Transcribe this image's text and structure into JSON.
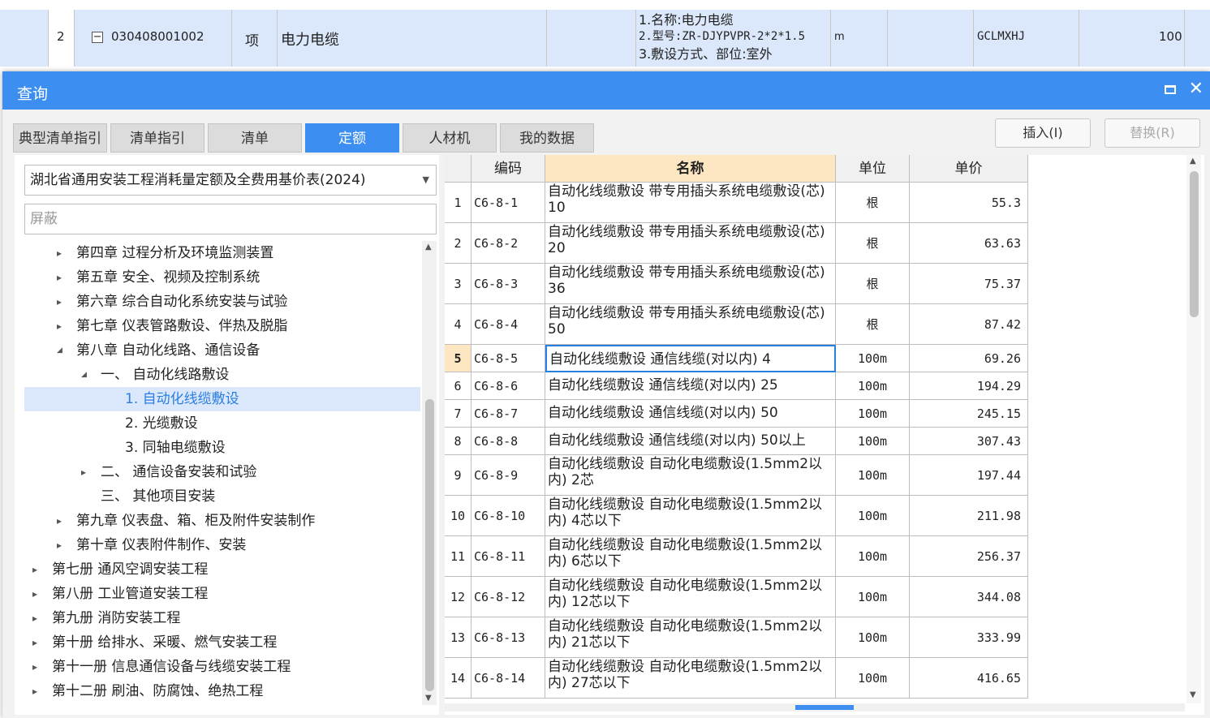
{
  "background_row": {
    "number": "2",
    "code": "030408001002",
    "type": "项",
    "name": "电力电缆",
    "features": [
      "1.名称:电力电缆",
      "2.型号:ZR-DJYPVPR-2*2*1.5",
      "3.敷设方式、部位:室外"
    ],
    "unit": "m",
    "expr": "GCLMXHJ",
    "qty": "100"
  },
  "dialog": {
    "title": "查询",
    "tabs": [
      {
        "label": "典型清单指引"
      },
      {
        "label": "清单指引"
      },
      {
        "label": "清单"
      },
      {
        "label": "定额"
      },
      {
        "label": "人材机"
      },
      {
        "label": "我的数据"
      }
    ],
    "active_tab": "定额",
    "insert_label": "插入(I)",
    "replace_label": "替换(R)"
  },
  "left": {
    "library": "湖北省通用安装工程消耗量定额及全费用基价表(2024)",
    "filter_placeholder": "屏蔽",
    "tree": [
      {
        "label": "第四章 过程分析及环境监测装置",
        "arrow": "▸"
      },
      {
        "label": "第五章 安全、视频及控制系统",
        "arrow": "▸"
      },
      {
        "label": "第六章 综合自动化系统安装与试验",
        "arrow": "▸"
      },
      {
        "label": "第七章 仪表管路敷设、伴热及脱脂",
        "arrow": "▸"
      },
      {
        "label": "第八章 自动化线路、通信设备",
        "arrow": "◢"
      },
      {
        "label": "一、 自动化线路敷设",
        "arrow": "◢"
      },
      {
        "label": "1. 自动化线缆敷设",
        "arrow": ""
      },
      {
        "label": "2. 光缆敷设",
        "arrow": ""
      },
      {
        "label": "3. 同轴电缆敷设",
        "arrow": ""
      },
      {
        "label": "二、 通信设备安装和试验",
        "arrow": "▸"
      },
      {
        "label": "三、 其他项目安装",
        "arrow": ""
      },
      {
        "label": "第九章 仪表盘、箱、柜及附件安装制作",
        "arrow": "▸"
      },
      {
        "label": "第十章 仪表附件制作、安装",
        "arrow": "▸"
      },
      {
        "label": "第七册 通风空调安装工程",
        "arrow": "▸"
      },
      {
        "label": "第八册 工业管道安装工程",
        "arrow": "▸"
      },
      {
        "label": "第九册 消防安装工程",
        "arrow": "▸"
      },
      {
        "label": "第十册 给排水、采暖、燃气安装工程",
        "arrow": "▸"
      },
      {
        "label": "第十一册 信息通信设备与线缆安装工程",
        "arrow": "▸"
      },
      {
        "label": "第十二册 刷油、防腐蚀、绝热工程",
        "arrow": "▸"
      }
    ]
  },
  "table": {
    "headers": {
      "code": "编码",
      "name": "名称",
      "unit": "单位",
      "price": "单价"
    },
    "rows": [
      {
        "idx": "1",
        "code": "C6-8-1",
        "name": "自动化线缆敷设 带专用插头系统电缆敷设(芯) 10",
        "unit": "根",
        "price": "55.3"
      },
      {
        "idx": "2",
        "code": "C6-8-2",
        "name": "自动化线缆敷设 带专用插头系统电缆敷设(芯) 20",
        "unit": "根",
        "price": "63.63"
      },
      {
        "idx": "3",
        "code": "C6-8-3",
        "name": "自动化线缆敷设 带专用插头系统电缆敷设(芯) 36",
        "unit": "根",
        "price": "75.37"
      },
      {
        "idx": "4",
        "code": "C6-8-4",
        "name": "自动化线缆敷设 带专用插头系统电缆敷设(芯) 50",
        "unit": "根",
        "price": "87.42"
      },
      {
        "idx": "5",
        "code": "C6-8-5",
        "name": "自动化线缆敷设 通信线缆(对以内) 4",
        "unit": "100m",
        "price": "69.26"
      },
      {
        "idx": "6",
        "code": "C6-8-6",
        "name": "自动化线缆敷设 通信线缆(对以内) 25",
        "unit": "100m",
        "price": "194.29"
      },
      {
        "idx": "7",
        "code": "C6-8-7",
        "name": "自动化线缆敷设 通信线缆(对以内) 50",
        "unit": "100m",
        "price": "245.15"
      },
      {
        "idx": "8",
        "code": "C6-8-8",
        "name": "自动化线缆敷设 通信线缆(对以内) 50以上",
        "unit": "100m",
        "price": "307.43"
      },
      {
        "idx": "9",
        "code": "C6-8-9",
        "name": "自动化线缆敷设 自动化电缆敷设(1.5mm2以内) 2芯",
        "unit": "100m",
        "price": "197.44"
      },
      {
        "idx": "10",
        "code": "C6-8-10",
        "name": "自动化线缆敷设 自动化电缆敷设(1.5mm2以内) 4芯以下",
        "unit": "100m",
        "price": "211.98"
      },
      {
        "idx": "11",
        "code": "C6-8-11",
        "name": "自动化线缆敷设 自动化电缆敷设(1.5mm2以内) 6芯以下",
        "unit": "100m",
        "price": "256.37"
      },
      {
        "idx": "12",
        "code": "C6-8-12",
        "name": "自动化线缆敷设 自动化电缆敷设(1.5mm2以内) 12芯以下",
        "unit": "100m",
        "price": "344.08"
      },
      {
        "idx": "13",
        "code": "C6-8-13",
        "name": "自动化线缆敷设 自动化电缆敷设(1.5mm2以内) 21芯以下",
        "unit": "100m",
        "price": "333.99"
      },
      {
        "idx": "14",
        "code": "C6-8-14",
        "name": "自动化线缆敷设 自动化电缆敷设(1.5mm2以内) 27芯以下",
        "unit": "100m",
        "price": "416.65"
      }
    ]
  }
}
